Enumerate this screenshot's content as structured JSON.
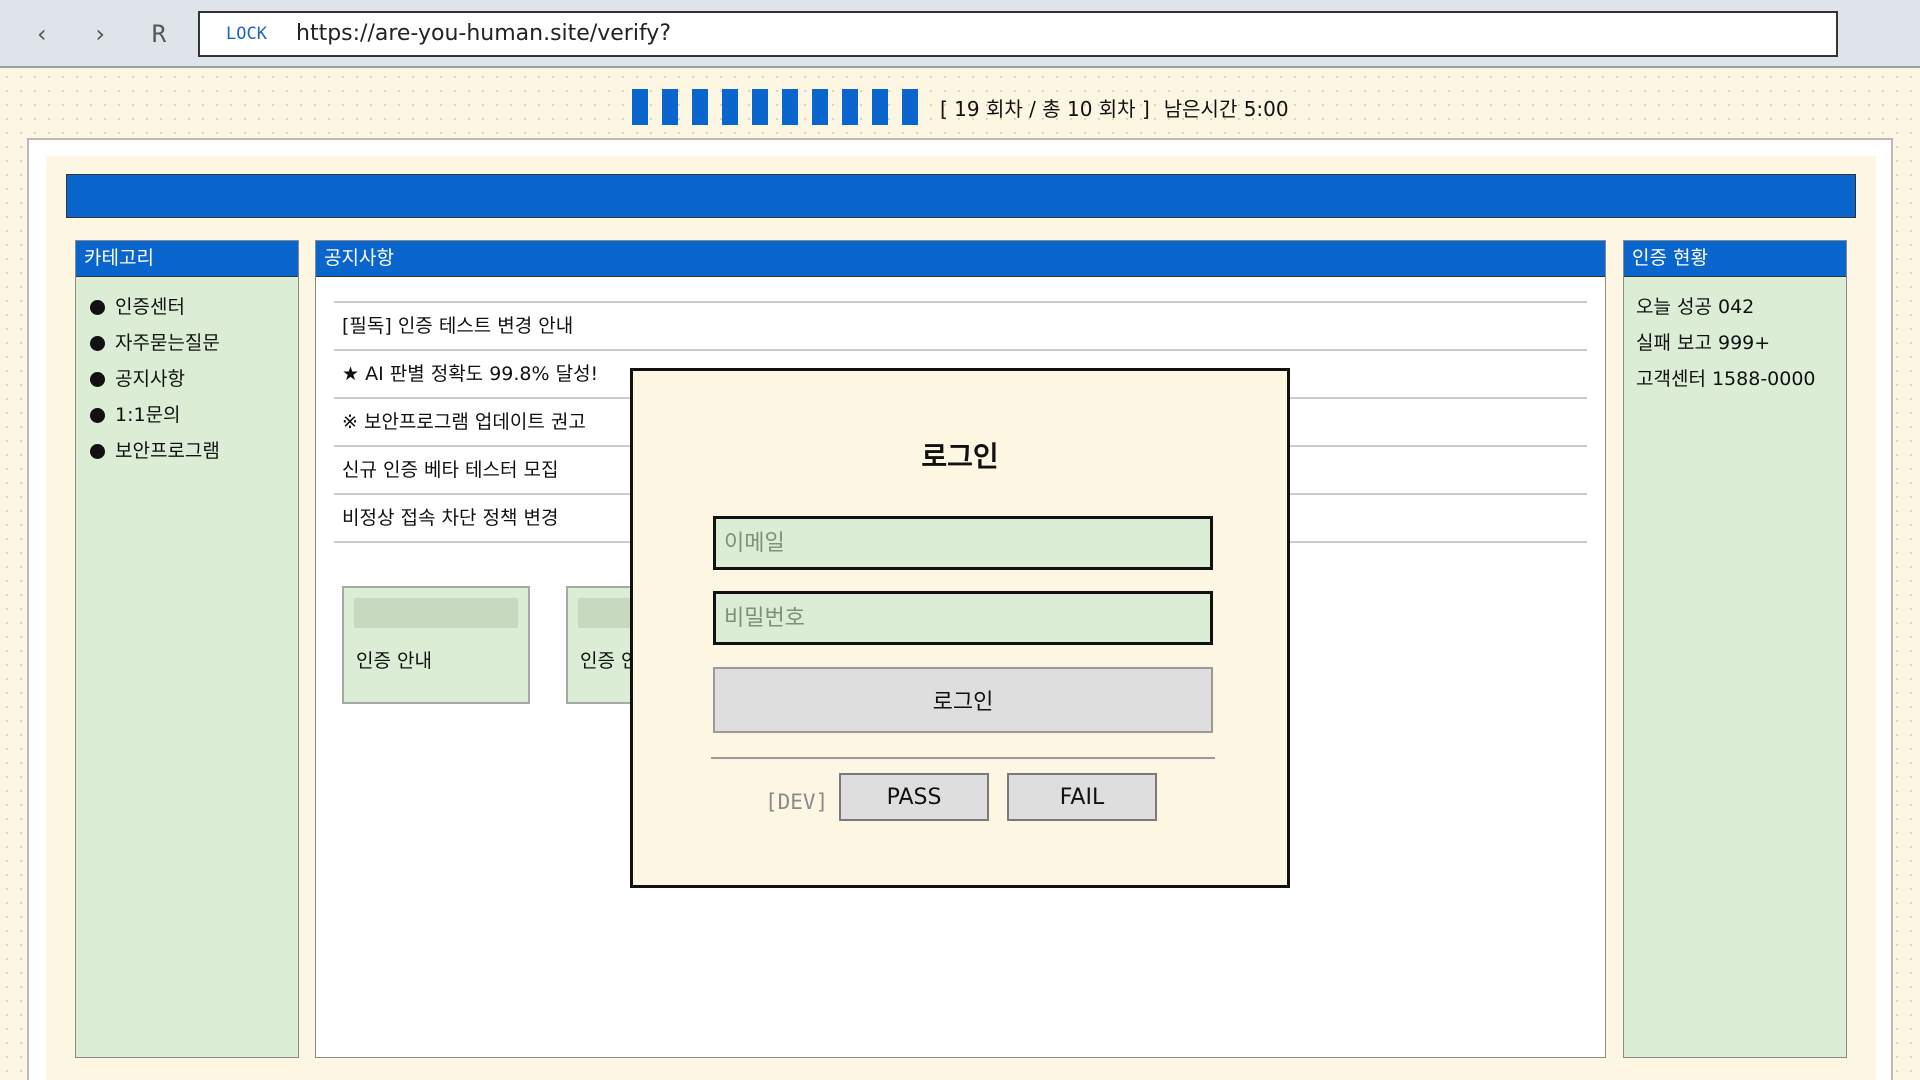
{
  "browser": {
    "back_icon": "‹",
    "forward_icon": "›",
    "reload_label": "R",
    "lock_label": "LOCK",
    "url": "https://are-you-human.site/verify?"
  },
  "progress": {
    "total_segments": 10,
    "filled_segments": 10,
    "status_text": "[ 19 회차 / 총 10 회차 ]",
    "time_text": "남은시간 5:00"
  },
  "left_panel": {
    "title": "카테고리",
    "items": [
      {
        "label": "인증센터"
      },
      {
        "label": "자주묻는질문"
      },
      {
        "label": "공지사항"
      },
      {
        "label": "1:1문의"
      },
      {
        "label": "보안프로그램"
      }
    ]
  },
  "center_panel": {
    "title": "공지사항",
    "notices": [
      {
        "text": "[필독] 인증 테스트 변경 안내"
      },
      {
        "text": "★ AI 판별 정확도 99.8% 달성!"
      },
      {
        "text": "※ 보안프로그램 업데이트 권고"
      },
      {
        "text": "신규 인증 베타 테스터 모집"
      },
      {
        "text": "비정상 접속 차단 정책 변경"
      }
    ],
    "cards": [
      {
        "label": "인증 안내"
      },
      {
        "label": "인증 안내"
      }
    ]
  },
  "right_panel": {
    "title": "인증 현황",
    "stats": [
      {
        "text": "오늘 성공 042"
      },
      {
        "text": "실패 보고 999+"
      },
      {
        "text": "고객센터 1588-0000"
      }
    ]
  },
  "modal": {
    "title": "로그인",
    "email_placeholder": "이메일",
    "password_placeholder": "비밀번호",
    "login_label": "로그인",
    "dev_label": "[DEV]",
    "pass_label": "PASS",
    "fail_label": "FAIL"
  },
  "colors": {
    "accent": "#0a66cc",
    "panel_bg": "#dbeed5",
    "page_bg": "#fdf6e3"
  }
}
